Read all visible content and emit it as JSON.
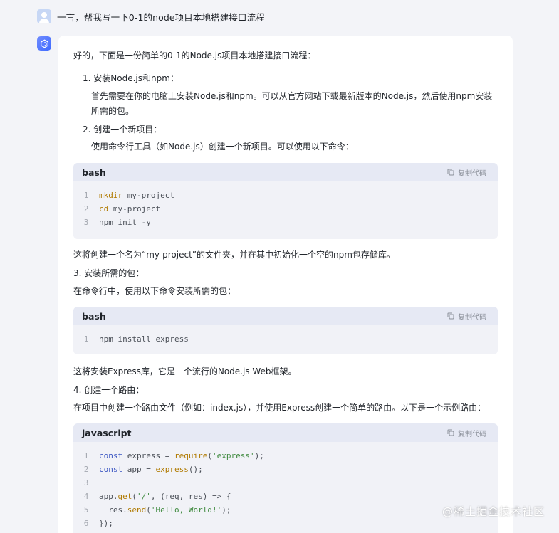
{
  "user": {
    "message": "一言，帮我写一下0-1的node项目本地搭建接口流程"
  },
  "answer": {
    "intro": "好的，下面是一份简单的0-1的Node.js项目本地搭建接口流程：",
    "step1_title": "1. 安装Node.js和npm：",
    "step1_line1": "首先需要在你的电脑上安装Node.js和npm。可以从官方网站下载最新版本的Node.js，然后使用npm安装",
    "step1_line2": "所需的包。",
    "step2_title": "2. 创建一个新项目：",
    "step2_desc": "使用命令行工具（如Node.js）创建一个新项目。可以使用以下命令：",
    "after_block1": "这将创建一个名为“my-project”的文件夹，并在其中初始化一个空的npm包存储库。",
    "step3_title": "3. 安装所需的包：",
    "step3_desc": "在命令行中，使用以下命令安装所需的包：",
    "after_block2": "这将安装Express库，它是一个流行的Node.js Web框架。",
    "step4_title": "4. 创建一个路由：",
    "step4_desc": "在项目中创建一个路由文件（例如：index.js），并使用Express创建一个简单的路由。以下是一个示例路由："
  },
  "code_blocks": [
    {
      "lang": "bash",
      "copy_label": "复制代码",
      "lines": [
        {
          "n": "1",
          "kw": "mkdir",
          "rest": " my-project"
        },
        {
          "n": "2",
          "kw": "cd",
          "rest": " my-project"
        },
        {
          "n": "3",
          "kw": "",
          "rest": "npm init -y"
        }
      ]
    },
    {
      "lang": "bash",
      "copy_label": "复制代码",
      "lines": [
        {
          "n": "1",
          "kw": "",
          "rest": "npm install express"
        }
      ]
    },
    {
      "lang": "javascript",
      "copy_label": "复制代码",
      "lines": [
        {
          "n": "1",
          "text": "const express = require('express');"
        },
        {
          "n": "2",
          "text": "const app = express();"
        },
        {
          "n": "3",
          "text": ""
        },
        {
          "n": "4",
          "text": "app.get('/', (req, res) => {"
        },
        {
          "n": "5",
          "text": "  res.send('Hello, World!');"
        },
        {
          "n": "6",
          "text": "});"
        }
      ]
    }
  ],
  "watermark": "@稀土掘金技术社区",
  "colors": {
    "page_bg": "#f3f4f8",
    "card_bg": "#ffffff",
    "code_bg": "#f1f2f7",
    "code_head_bg": "#e6e9f4",
    "bot_accent": "#3f6bff"
  }
}
